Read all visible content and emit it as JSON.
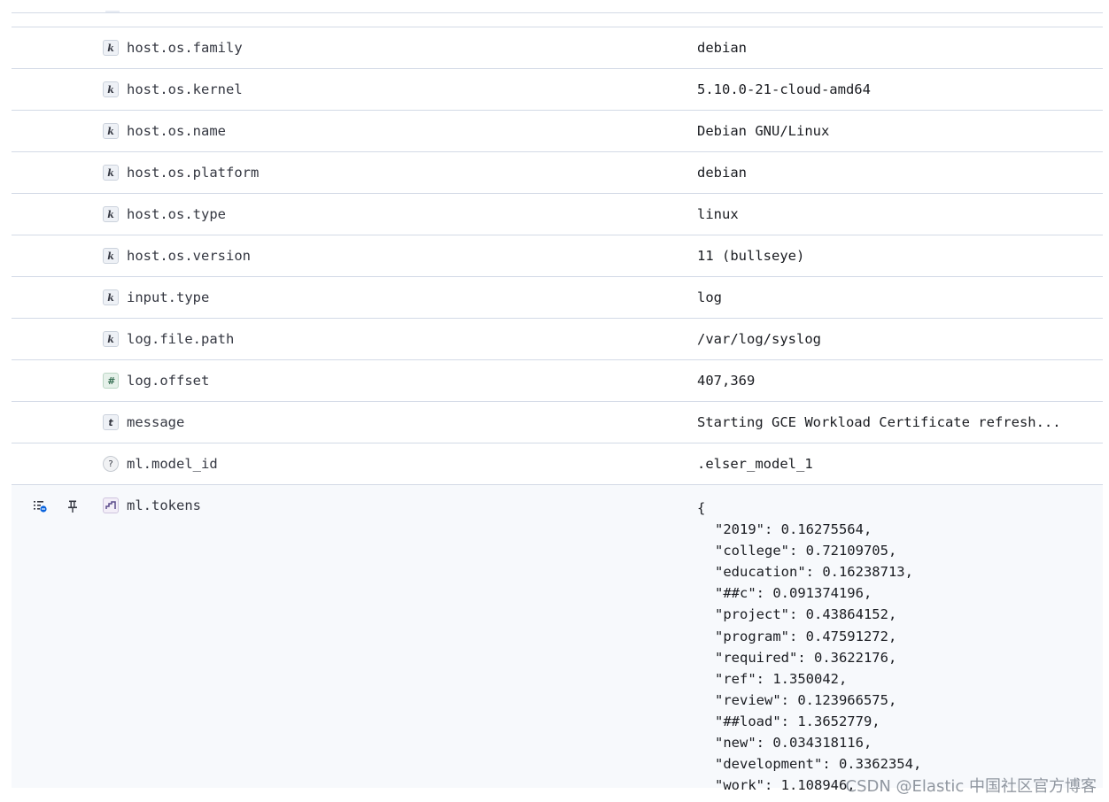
{
  "rows": [
    {
      "type": "keyword",
      "type_glyph": "k",
      "field": "host.os.family",
      "value": "debian"
    },
    {
      "type": "keyword",
      "type_glyph": "k",
      "field": "host.os.kernel",
      "value": "5.10.0-21-cloud-amd64"
    },
    {
      "type": "keyword",
      "type_glyph": "k",
      "field": "host.os.name",
      "value": "Debian GNU/Linux"
    },
    {
      "type": "keyword",
      "type_glyph": "k",
      "field": "host.os.platform",
      "value": "debian"
    },
    {
      "type": "keyword",
      "type_glyph": "k",
      "field": "host.os.type",
      "value": "linux"
    },
    {
      "type": "keyword",
      "type_glyph": "k",
      "field": "host.os.version",
      "value": "11 (bullseye)"
    },
    {
      "type": "keyword",
      "type_glyph": "k",
      "field": "input.type",
      "value": "log"
    },
    {
      "type": "keyword",
      "type_glyph": "k",
      "field": "log.file.path",
      "value": "/var/log/syslog"
    },
    {
      "type": "number",
      "type_glyph": "#",
      "field": "log.offset",
      "value": "407,369"
    },
    {
      "type": "text",
      "type_glyph": "t",
      "field": "message",
      "value": "Starting GCE Workload Certificate refresh..."
    },
    {
      "type": "unknown",
      "type_glyph": "?",
      "field": "ml.model_id",
      "value": ".elser_model_1"
    }
  ],
  "expanded_row": {
    "type": "rank_features",
    "field": "ml.tokens",
    "action_icons": [
      "toggle-column-icon",
      "pin-icon"
    ],
    "json_lines": [
      "{",
      "\"2019\": 0.16275564,",
      "\"college\": 0.72109705,",
      "\"education\": 0.16238713,",
      "\"##c\": 0.091374196,",
      "\"project\": 0.43864152,",
      "\"program\": 0.47591272,",
      "\"required\": 0.3622176,",
      "\"ref\": 1.350042,",
      "\"review\": 0.123966575,",
      "\"##load\": 1.3652779,",
      "\"new\": 0.034318116,",
      "\"development\": 0.3362354,",
      "\"work\": 1.108946,"
    ]
  },
  "watermark": "CSDN @Elastic 中国社区官方博客"
}
